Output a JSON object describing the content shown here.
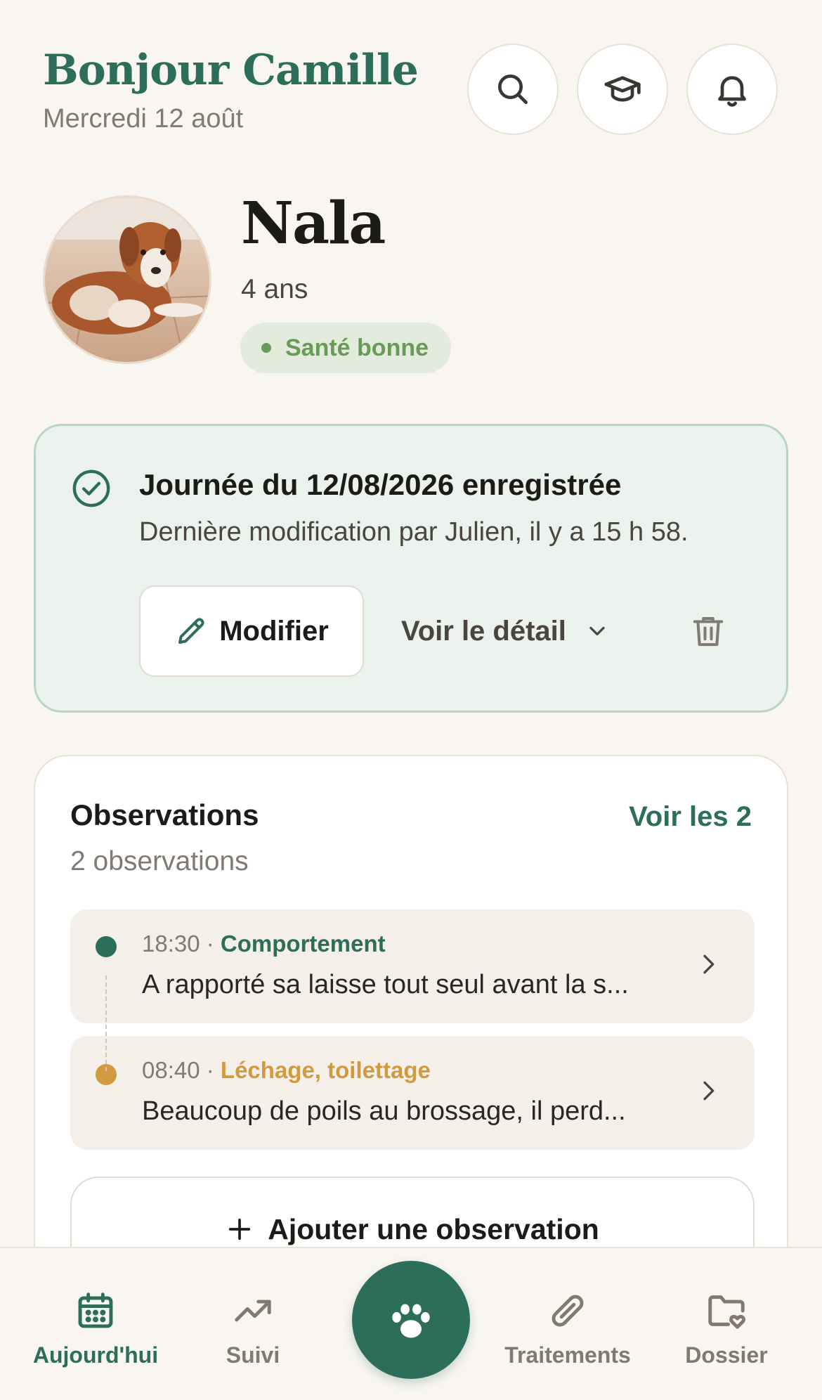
{
  "header": {
    "greeting": "Bonjour Camille",
    "date": "Mercredi 12 août",
    "icons": [
      "search-icon",
      "graduation-cap-icon",
      "bell-icon"
    ]
  },
  "pet": {
    "name": "Nala",
    "age": "4 ans",
    "health_label": "Santé bonne",
    "health_color": "#6a9a58"
  },
  "day_card": {
    "title": "Journée du 12/08/2026 enregistrée",
    "subtitle": "Dernière modification par Julien, il y a 15 h 58.",
    "modify_label": "Modifier",
    "detail_label": "Voir le détail"
  },
  "observations": {
    "title": "Observations",
    "count_label": "2 observations",
    "see_all_label": "Voir les 2",
    "items": [
      {
        "time": "18:30",
        "separator": " · ",
        "category": "Comportement",
        "category_color": "#2d6e5a",
        "text": "A rapporté sa laisse tout seul avant la s..."
      },
      {
        "time": "08:40",
        "separator": " · ",
        "category": "Léchage, toilettage",
        "category_color": "#d19a3e",
        "text": "Beaucoup de poils au brossage, il perd..."
      }
    ],
    "add_label": "Ajouter une observation"
  },
  "nav": {
    "items": [
      {
        "label": "Aujourd'hui",
        "icon": "calendar-icon",
        "active": true
      },
      {
        "label": "Suivi",
        "icon": "trend-icon",
        "active": false
      },
      {
        "label": "Traitements",
        "icon": "pill-icon",
        "active": false
      },
      {
        "label": "Dossier",
        "icon": "folder-heart-icon",
        "active": false
      }
    ],
    "center_icon": "paw-icon"
  },
  "colors": {
    "accent": "#2d6e5a",
    "background": "#f9f6f1",
    "card_green": "#ebf1ec"
  }
}
